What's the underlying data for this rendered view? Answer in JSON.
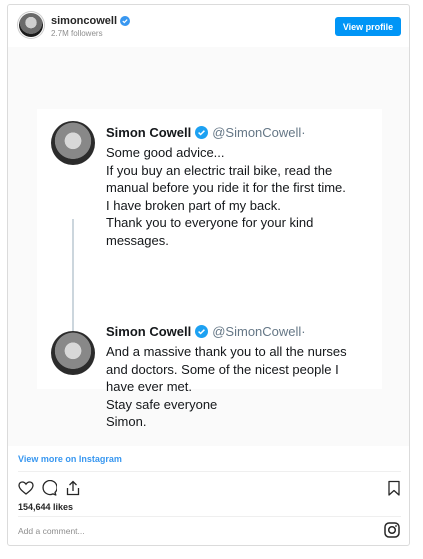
{
  "post": {
    "username": "simoncowell",
    "followers": "2.7M followers",
    "view_profile": "View profile",
    "view_more": "View more on Instagram",
    "likes": "154,644 likes",
    "comment_placeholder": "Add a comment..."
  },
  "tweets": [
    {
      "name": "Simon Cowell",
      "handle": "@SimonCowell·",
      "lines": [
        "Some good advice...",
        "If you buy an electric trail bike, read the",
        "manual before you ride it for the first time.",
        "I have broken part of my back.",
        "Thank you to everyone for your kind",
        "messages."
      ]
    },
    {
      "name": "Simon Cowell",
      "handle": "@SimonCowell·",
      "lines": [
        "And a massive thank you to all the nurses",
        "and doctors. Some of the nicest people I",
        "have ever met.",
        "Stay safe everyone",
        "Simon."
      ]
    }
  ],
  "colors": {
    "accent": "#0095f6",
    "link": "#3897f0",
    "verified": "#1da1f2"
  },
  "icons": [
    "verified-icon",
    "heart-icon",
    "comment-icon",
    "share-icon",
    "bookmark-icon",
    "instagram-icon"
  ]
}
